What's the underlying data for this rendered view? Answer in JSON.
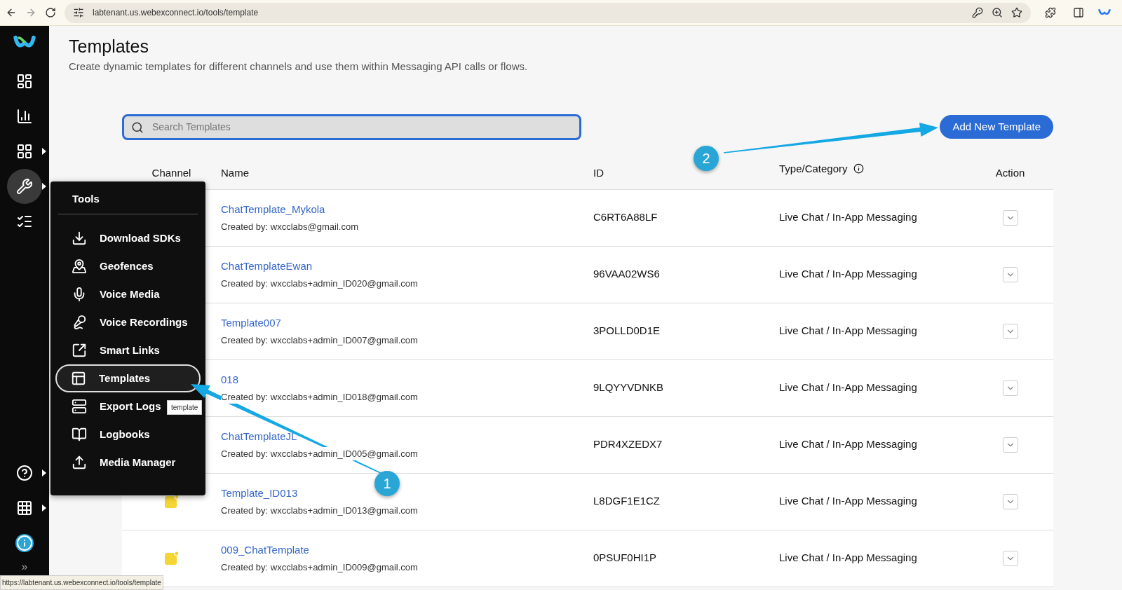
{
  "browser": {
    "url": "labtenant.us.webexconnect.io/tools/template"
  },
  "sidebar": {
    "items": [
      {
        "selected": false,
        "submenu": false
      },
      {
        "selected": false,
        "submenu": false
      },
      {
        "selected": false,
        "submenu": true
      },
      {
        "selected": true,
        "submenu": true
      },
      {
        "selected": false,
        "submenu": false
      }
    ],
    "bottom_items": [
      {
        "submenu": true
      },
      {
        "submenu": true
      },
      {
        "submenu": false
      }
    ],
    "collapse": "»"
  },
  "page": {
    "title": "Templates",
    "subtitle": "Create dynamic templates for different channels and use them within Messaging API calls or flows.",
    "search": {
      "placeholder": "Search Templates"
    },
    "add_button": "Add New Template"
  },
  "table": {
    "columns": [
      "Channel",
      "Name",
      "ID",
      "Type/Category",
      "Action"
    ],
    "rows": [
      {
        "name": "ChatTemplate_Mykola",
        "created": "Created by: wxcclabs@gmail.com",
        "id": "C6RT6A88LF",
        "type": "Live Chat / In-App Messaging"
      },
      {
        "name": "ChatTemplateEwan",
        "created": "Created by: wxcclabs+admin_ID020@gmail.com",
        "id": "96VAA02WS6",
        "type": "Live Chat / In-App Messaging"
      },
      {
        "name": "Template007",
        "created": "Created by: wxcclabs+admin_ID007@gmail.com",
        "id": "3POLLD0D1E",
        "type": "Live Chat / In-App Messaging"
      },
      {
        "name": "018",
        "created": "Created by: wxcclabs+admin_ID018@gmail.com",
        "id": "9LQYYVDNKB",
        "type": "Live Chat / In-App Messaging"
      },
      {
        "name": "ChatTemplateJL",
        "created": "Created by: wxcclabs+admin_ID005@gmail.com",
        "id": "PDR4XZEDX7",
        "type": "Live Chat / In-App Messaging"
      },
      {
        "channel_icon": true,
        "name": "Template_ID013",
        "created": "Created by: wxcclabs+admin_ID013@gmail.com",
        "id": "L8DGF1E1CZ",
        "type": "Live Chat / In-App Messaging"
      },
      {
        "channel_icon": true,
        "name": "009_ChatTemplate",
        "created": "Created by: wxcclabs+admin_ID009@gmail.com",
        "id": "0PSUF0HI1P",
        "type": "Live Chat / In-App Messaging"
      }
    ]
  },
  "tools_menu": {
    "title": "Tools",
    "items": [
      {
        "label": "Download SDKs",
        "selected": false
      },
      {
        "label": "Geofences",
        "selected": false
      },
      {
        "label": "Voice Media",
        "selected": false
      },
      {
        "label": "Voice Recordings",
        "selected": false
      },
      {
        "label": "Smart Links",
        "selected": false
      },
      {
        "label": "Templates",
        "selected": true
      },
      {
        "label": "Export Logs",
        "selected": false
      },
      {
        "label": "Logbooks",
        "selected": false
      },
      {
        "label": "Media Manager",
        "selected": false
      }
    ]
  },
  "tooltip": "template",
  "annotations": [
    {
      "label": "1"
    },
    {
      "label": "2"
    }
  ],
  "status_url": "https://labtenant.us.webexconnect.io/tools/template"
}
